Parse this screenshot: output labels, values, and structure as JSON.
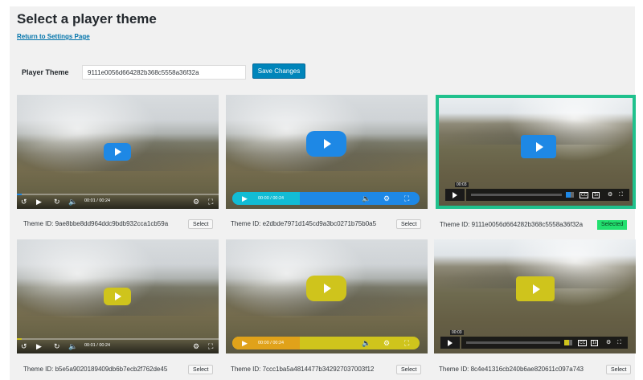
{
  "page": {
    "title": "Select a player theme",
    "back_link": "Return to Settings Page",
    "field_label": "Player Theme",
    "field_value": "9111e0056d664282b368c5558a36f32a",
    "save_label": "Save Changes"
  },
  "themes": [
    {
      "id_text": "Theme ID: 9ae8bbe8dd964ddc9bdb932cca1cb59a",
      "button": "Select",
      "accent": "#1e88e5",
      "time": "00:01 / 00:24"
    },
    {
      "id_text": "Theme ID: e2dbde7971d145cd9a3bc0271b75b0a5",
      "button": "Select",
      "accent": "#1e88e5",
      "time": "00:00 / 00:24"
    },
    {
      "id_text": "Theme ID: 9111e0056d664282b368c5558a36f32a",
      "button": "Selected",
      "accent": "#1e88e5",
      "time": "00:03",
      "speed": "1x"
    },
    {
      "id_text": "Theme ID: b5e5a9020189409db6b7ecb2f762de45",
      "button": "Select",
      "accent": "#cfc41c",
      "time": "00:01 / 00:24"
    },
    {
      "id_text": "Theme ID: 7ccc1ba5a4814477b342927037003f12",
      "button": "Select",
      "accent": "#cfc41c",
      "time": "00:00 / 00:24"
    },
    {
      "id_text": "Theme ID: 8c4e41316cb240b6ae820611c097a743",
      "button": "Select",
      "accent": "#cfc41c",
      "time": "00:03",
      "speed": "1x"
    }
  ],
  "colors": {
    "background": "#f1f1f1",
    "primary_button": "#0085ba",
    "selected_border": "#20c18d",
    "selected_badge": "#22e06f",
    "blue_accent": "#1e88e5",
    "yellow_accent": "#cfc41c"
  },
  "icons": [
    "rewind-icon",
    "play-icon",
    "forward-icon",
    "volume-icon",
    "gear-icon",
    "fullscreen-icon",
    "captions-icon"
  ]
}
